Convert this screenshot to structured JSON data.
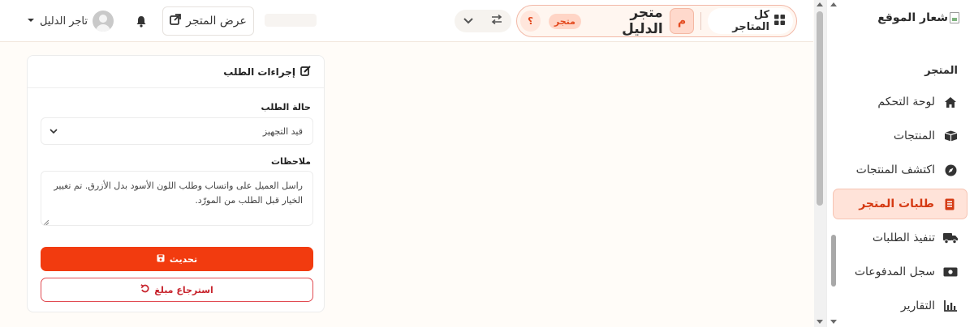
{
  "header": {
    "all_stores_label": "كل المتاجر",
    "store_initial": "م",
    "store_name": "متجر الدليل",
    "store_badge": "متجر",
    "help_label": "؟",
    "view_store_label": "عرض المتجر",
    "user_name": "تاجر الدليل"
  },
  "sidebar": {
    "logo_text": "شعار الموقع",
    "section_title": "المتجر",
    "items": [
      {
        "label": "لوحة التحكم",
        "icon": "home-icon"
      },
      {
        "label": "المنتجات",
        "icon": "box-icon"
      },
      {
        "label": "اكتشف المنتجات",
        "icon": "compass-icon"
      },
      {
        "label": "طلبات المتجر",
        "icon": "receipt-icon",
        "active": true
      },
      {
        "label": "تنفيذ الطلبات",
        "icon": "truck-icon"
      },
      {
        "label": "سجل المدفوعات",
        "icon": "money-icon"
      },
      {
        "label": "التقارير",
        "icon": "chart-icon"
      }
    ]
  },
  "order_actions": {
    "title": "إجراءات الطلب",
    "status_label": "حالة الطلب",
    "status_value": "قيد التجهيز",
    "notes_label": "ملاحظات",
    "notes_value": "راسل العميل على واتساب وطلب اللون الأسود بدل الأزرق. تم تغيير الخيار قبل الطلب من المورّد.",
    "update_button": "تحديث",
    "refund_button": "استرجاع مبلغ"
  },
  "colors": {
    "accent": "#f23b0f",
    "danger": "#c8252e",
    "active_bg": "#ffe3d9"
  }
}
